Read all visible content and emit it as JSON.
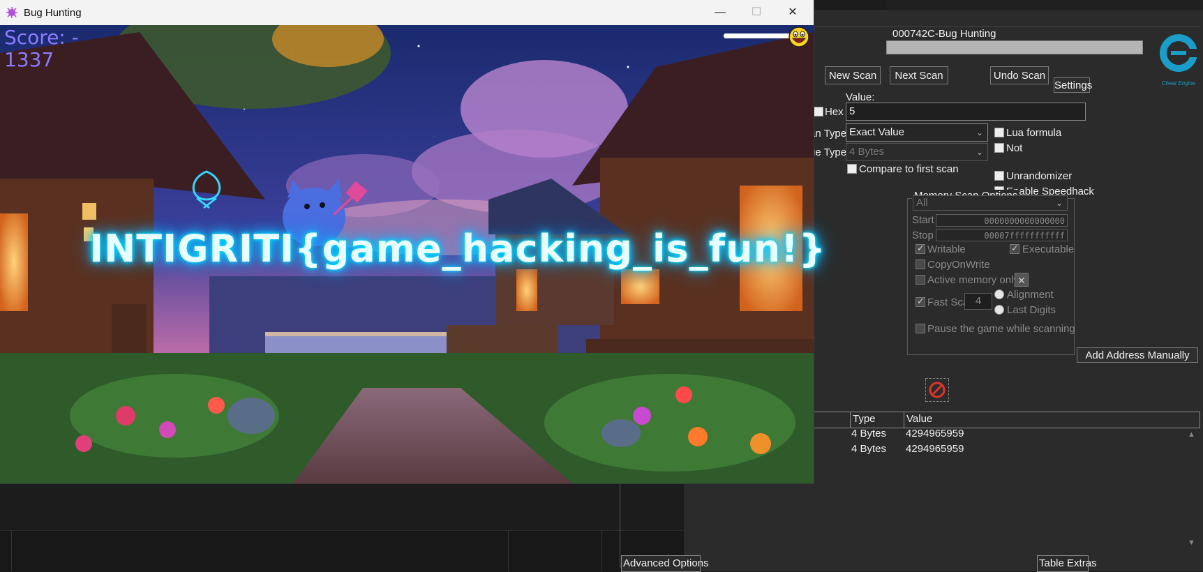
{
  "game_window": {
    "title": "Bug Hunting",
    "controls": {
      "minimize": "—",
      "maximize": "☐",
      "close": "✕"
    },
    "score_label": "Score: -",
    "score_value": "1337",
    "health_fraction": 1.0,
    "flag_text": "INTIGRITI{game_hacking_is_fun!}"
  },
  "cheat_engine": {
    "process_title": "000742C-Bug Hunting",
    "buttons": {
      "new_scan": "New Scan",
      "next_scan": "Next Scan",
      "undo_scan": "Undo Scan",
      "settings": "Settings",
      "add_address_manually": "Add Address Manually"
    },
    "value_label": "Value:",
    "hex_label": "Hex",
    "value_input": "5",
    "scan_type_label": "an Type",
    "scan_type_value": "Exact Value",
    "value_type_label": "ue Type",
    "value_type_value": "4 Bytes",
    "compare_first_label": "Compare to first scan",
    "right_options": {
      "lua_formula": "Lua formula",
      "not": "Not",
      "unrandomizer": "Unrandomizer",
      "enable_speedhack": "Enable Speedhack"
    },
    "memory_scan": {
      "title": "Memory Scan Options",
      "region": "All",
      "start_label": "Start",
      "start_value": "0000000000000000",
      "stop_label": "Stop",
      "stop_value": "00007fffffffffff",
      "writable": "Writable",
      "executable": "Executable",
      "copy_on_write": "CopyOnWrite",
      "active_memory_only": "Active memory only",
      "fast_scan": "Fast Scan",
      "fast_scan_value": "4",
      "alignment": "Alignment",
      "last_digits": "Last Digits",
      "pause_game": "Pause the game while scanning"
    },
    "address_table": {
      "columns": [
        "Type",
        "Value"
      ],
      "rows": [
        {
          "type": "4 Bytes",
          "value": "4294965959"
        },
        {
          "type": "4 Bytes",
          "value": "4294965959"
        }
      ]
    },
    "bottom": {
      "advanced_options": "Advanced Options",
      "table_extras": "Table Extras"
    },
    "colors": {
      "logo": "#1a9ec9",
      "stop_icon": "#e0332f"
    }
  }
}
